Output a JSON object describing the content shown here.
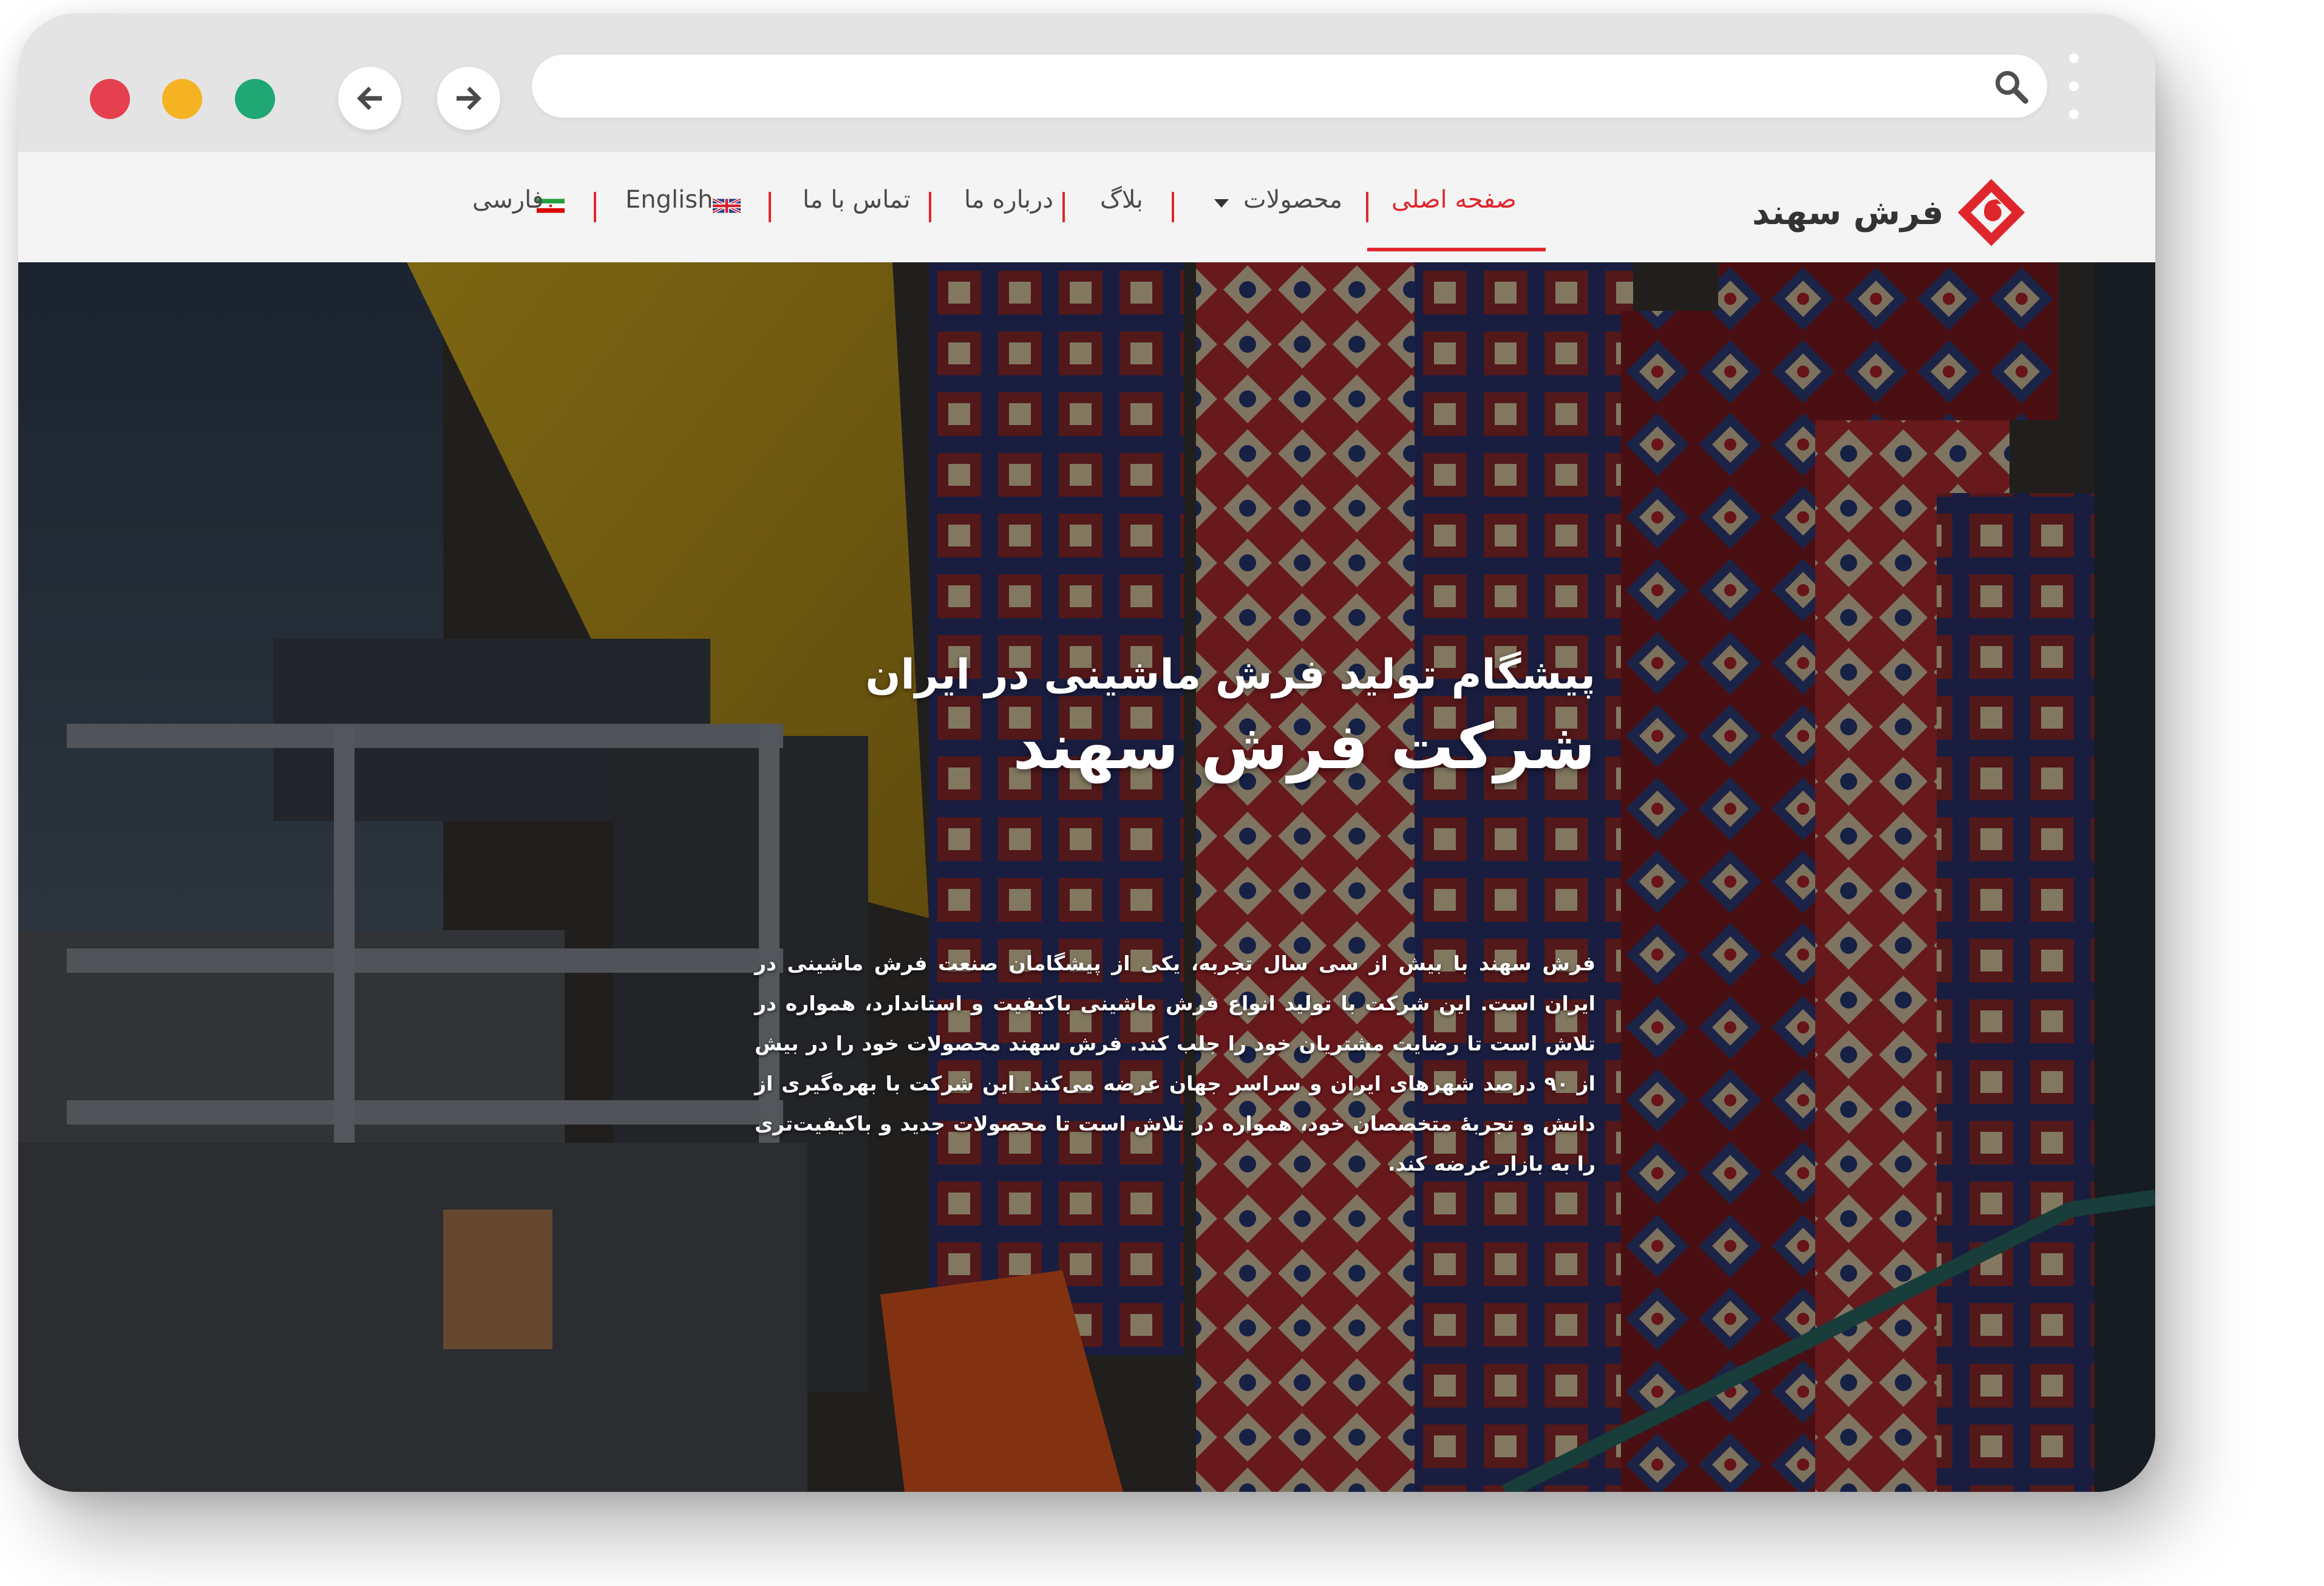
{
  "browser": {
    "window_controls": [
      "close",
      "minimize",
      "maximize"
    ],
    "back_icon": "arrow-left-icon",
    "forward_icon": "arrow-right-icon",
    "search_icon": "search-icon",
    "address_value": ""
  },
  "site": {
    "logo_text": "فرش سهند",
    "nav": {
      "home": "صفحه اصلی",
      "products": "محصولات",
      "blog": "بلاگ",
      "about": "درباره ما",
      "contact": "تماس با ما",
      "english": "English",
      "farsi": "فارسی"
    }
  },
  "hero": {
    "subtitle": "پیشگام تولید فرش ماشینی در ایران",
    "title": "شرکت فرش سهند",
    "description": "فرش سهند با بیش از سی سال تجربه، یکی از پیشگامان صنعت فرش ماشینی در ایران است. این شرکت با تولید انواع فرش ماشینی باکیفیت و استاندارد، همواره در تلاش است تا رضایت مشتریان خود را جلب کند. فرش سهند محصولات خود را در بیش از ۹۰ درصد شهرهای ایران و سراسر جهان عرضه می‌کند. این شرکت با بهره‌گیری از دانش و تجربهٔ متخصصان خود، همواره در تلاش است تا محصولات جدید و باکیفیت‌تری را به بازار عرضه کند."
  },
  "colors": {
    "accent": "#e0262d",
    "close_dot": "#e5404f",
    "minimize_dot": "#f5b324",
    "maximize_dot": "#1fa774",
    "chrome": "#e4e4e4",
    "header": "#f4f4f4"
  }
}
